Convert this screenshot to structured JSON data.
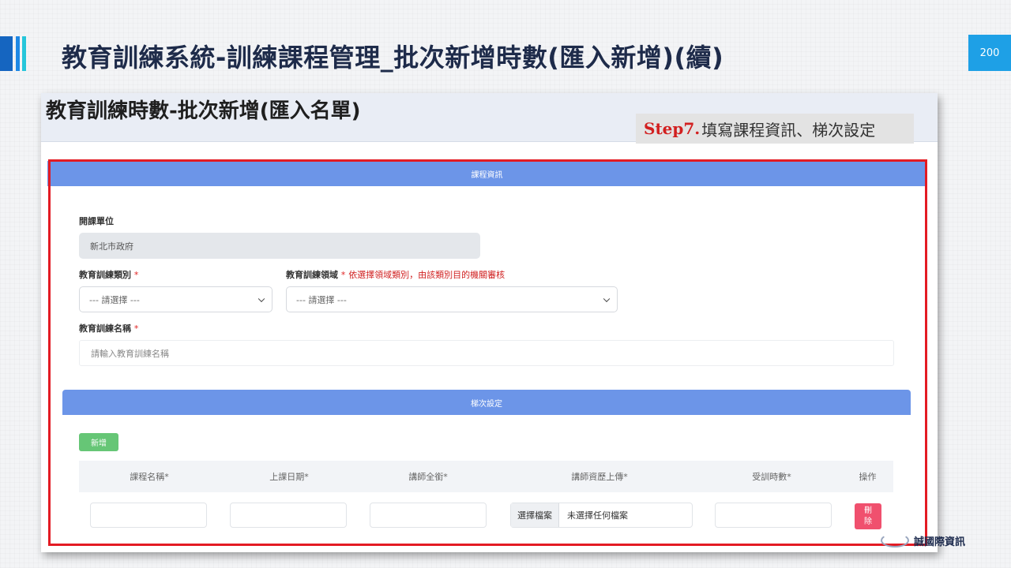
{
  "slide": {
    "title": "教育訓練系統-訓練課程管理_批次新增時數(匯入新增)(續)",
    "page_number": "200",
    "colors": {
      "accent_dark": "#1565c0",
      "accent_light": "#26c6da",
      "page_badge": "#1ea0e6"
    }
  },
  "screenshot": {
    "title": "教育訓練時數-批次新增(匯入名單)",
    "step": {
      "label": "Step7.",
      "text": "填寫課程資訊、梯次設定"
    },
    "course_section": {
      "header": "課程資訊",
      "unit_label": "開課單位",
      "unit_value": "新北市政府",
      "category_label": "教育訓練類別",
      "category_required": "*",
      "category_placeholder": "--- 請選擇 ---",
      "domain_label": "教育訓練領域",
      "domain_required": "*",
      "domain_note": "依選擇領域類別，由該類別目的機關審核",
      "domain_placeholder": "--- 請選擇 ---",
      "name_label": "教育訓練名稱",
      "name_required": "*",
      "name_placeholder": "請輸入教育訓練名稱"
    },
    "session_section": {
      "header": "梯次設定",
      "add_button": "新增",
      "columns": [
        "課程名稱*",
        "上課日期*",
        "講師全銜*",
        "講師資歷上傳*",
        "受訓時數*",
        "操作"
      ],
      "file_button": "選擇檔案",
      "file_status": "未選擇任何檔案",
      "delete_button_line1": "刪",
      "delete_button_line2": "除"
    },
    "colors": {
      "section_header": "#6c95e8",
      "add_button": "#66c676",
      "delete_button": "#f0506e",
      "highlight_frame": "#e31b23"
    }
  },
  "logo": {
    "text": "誠國際資訊"
  }
}
